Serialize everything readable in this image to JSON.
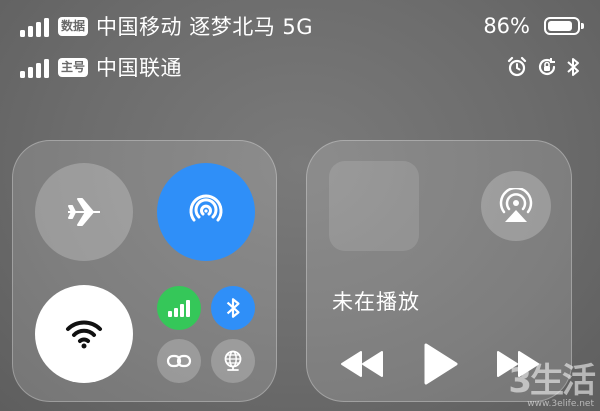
{
  "status_bar": {
    "sim1": {
      "badge": "数据",
      "carrier": "中国移动 逐梦北马 5G"
    },
    "sim2": {
      "badge": "主号",
      "carrier": "中国联通"
    },
    "battery_percent": "86%",
    "battery_level": 0.86,
    "icons": [
      "alarm-icon",
      "rotation-lock-icon",
      "bluetooth-icon"
    ]
  },
  "connectivity": {
    "airplane": {
      "icon": "airplane-icon",
      "on": false
    },
    "airdrop": {
      "icon": "airdrop-icon",
      "on": true
    },
    "wifi": {
      "icon": "wifi-icon",
      "on": true
    },
    "cellular": {
      "icon": "cellular-data-icon",
      "on": true
    },
    "bluetooth": {
      "icon": "bluetooth-icon",
      "on": true
    },
    "hotspot": {
      "icon": "personal-hotspot-icon",
      "on": false
    },
    "vpn": {
      "icon": "globe-network-icon",
      "on": false
    }
  },
  "media": {
    "now_playing_label": "未在播放",
    "airplay_icon": "airplay-icon",
    "controls": [
      "rewind-icon",
      "play-icon",
      "fast-forward-icon"
    ]
  },
  "watermark": {
    "main": "3生活",
    "sub": "www.3elife.net"
  },
  "colors": {
    "accent_blue": "#2f8ff8",
    "cellular_green": "#35c759",
    "bluetooth_blue": "#2f8ff8"
  }
}
